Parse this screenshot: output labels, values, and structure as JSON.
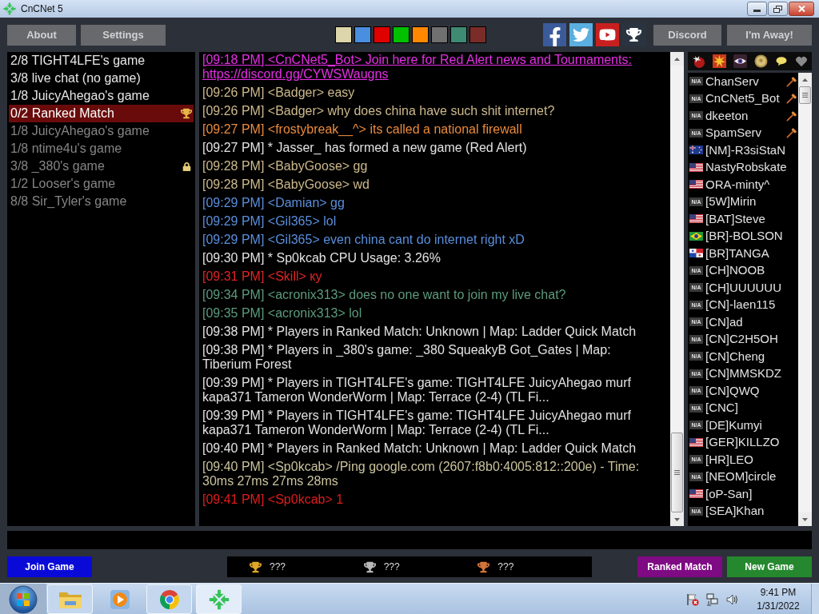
{
  "window": {
    "title": "CnCNet 5"
  },
  "toolbar": {
    "left_buttons": [
      "About",
      "Settings"
    ],
    "color_swatches": [
      {
        "color": "#ddd5ac"
      },
      {
        "color": "#4a8ee0"
      },
      {
        "color": "#e00000"
      },
      {
        "color": "#00c000"
      },
      {
        "color": "#ff8800"
      },
      {
        "color": "#707070"
      },
      {
        "color": "#3e8a72"
      },
      {
        "color": "#7a2c28"
      }
    ],
    "right_buttons": [
      "Discord",
      "I'm Away!"
    ]
  },
  "game_list": [
    {
      "text": "2/8 TIGHT4LFE's game",
      "selected": false,
      "disabled": false,
      "ranked": false,
      "locked": false
    },
    {
      "text": "3/8 live chat (no game)",
      "selected": false,
      "disabled": false,
      "ranked": false,
      "locked": false
    },
    {
      "text": "1/8 JuicyAhegao's game",
      "selected": false,
      "disabled": false,
      "ranked": false,
      "locked": false
    },
    {
      "text": "0/2 Ranked Match",
      "selected": true,
      "disabled": false,
      "ranked": true,
      "locked": false
    },
    {
      "text": "1/8 JuicyAhegao's game",
      "selected": false,
      "disabled": true,
      "ranked": false,
      "locked": false
    },
    {
      "text": "1/8 ntime4u's game",
      "selected": false,
      "disabled": true,
      "ranked": false,
      "locked": false
    },
    {
      "text": "3/8 _380's game",
      "selected": false,
      "disabled": true,
      "ranked": false,
      "locked": true
    },
    {
      "text": "1/2 Looser's game",
      "selected": false,
      "disabled": true,
      "ranked": false,
      "locked": false
    },
    {
      "text": "8/8 Sir_Tyler's game",
      "selected": false,
      "disabled": true,
      "ranked": false,
      "locked": false
    }
  ],
  "chat": [
    {
      "kind": "link",
      "text": "[09:18 PM] <CnCNet5_Bot> Join here for Red Alert news and Tournaments:",
      "link": "https://discord.gg/CYWSWaugns",
      "color": "#e62ee6"
    },
    {
      "kind": "text",
      "text": "[09:26 PM] <Badger> easy",
      "color": "#cdb98c"
    },
    {
      "kind": "text",
      "text": "[09:26 PM] <Badger> why does china have such shit internet?",
      "color": "#cdb98c"
    },
    {
      "kind": "text",
      "text": "[09:27 PM] <frostybreak__^> its called a national firewall",
      "color": "#ea8a3c"
    },
    {
      "kind": "text",
      "text": "[09:27 PM] * Jasser_ has formed a new game (Red Alert)",
      "color": "#e2e2e2"
    },
    {
      "kind": "text",
      "text": "[09:28 PM] <BabyGoose> gg",
      "color": "#cdb98c"
    },
    {
      "kind": "text",
      "text": "[09:28 PM] <BabyGoose> wd",
      "color": "#cdb98c"
    },
    {
      "kind": "text",
      "text": "[09:29 PM] <Damian> gg",
      "color": "#5a8edc"
    },
    {
      "kind": "text",
      "text": "[09:29 PM] <Gil365> lol",
      "color": "#5a8edc"
    },
    {
      "kind": "text",
      "text": "[09:29 PM] <Gil365> even china cant do internet right xD",
      "color": "#5a8edc"
    },
    {
      "kind": "text",
      "text": "[09:30 PM] * Sp0kcab CPU Usage: 3.26%",
      "color": "#e2e2e2"
    },
    {
      "kind": "text",
      "text": "[09:31 PM] <Skill> ку",
      "color": "#e02424"
    },
    {
      "kind": "text",
      "text": "[09:34 PM] <acronix313> does no one want to join my live chat?",
      "color": "#5c9a7e"
    },
    {
      "kind": "text",
      "text": "[09:35 PM] <acronix313> lol",
      "color": "#5c9a7e"
    },
    {
      "kind": "text",
      "text": "[09:38 PM] * Players in Ranked Match: Unknown | Map: Ladder Quick Match",
      "color": "#e2e2e2"
    },
    {
      "kind": "text",
      "text": "[09:38 PM] * Players in _380's game: _380 SqueakyB Got_Gates | Map: Tiberium Forest",
      "color": "#e2e2e2"
    },
    {
      "kind": "text",
      "text": "[09:39 PM] * Players in TIGHT4LFE's game: TIGHT4LFE JuicyAhegao murf kapa371 Tameron WonderWorm | Map: Terrace (2-4) (TL Fi...",
      "color": "#e2e2e2"
    },
    {
      "kind": "text",
      "text": "[09:39 PM] * Players in TIGHT4LFE's game: TIGHT4LFE JuicyAhegao murf kapa371 Tameron WonderWorm | Map: Terrace (2-4) (TL Fi...",
      "color": "#e2e2e2"
    },
    {
      "kind": "text",
      "text": "[09:40 PM] * Players in Ranked Match: Unknown | Map: Ladder Quick Match",
      "color": "#e2e2e2"
    },
    {
      "kind": "text",
      "text": "[09:40 PM] <Sp0kcab> /Ping google.com (2607:f8b0:4005:812::200e) - Time: 30ms 27ms 27ms 28ms",
      "color": "#c9c29c"
    },
    {
      "kind": "text",
      "text": "[09:41 PM] <Sp0kcab> 1",
      "color": "#e01c1c"
    }
  ],
  "users": [
    {
      "name": "ChanServ",
      "kind": "label",
      "flag": "N/A",
      "operator": true
    },
    {
      "name": "CnCNet5_Bot",
      "kind": "label",
      "flag": "N/A",
      "operator": true
    },
    {
      "name": "dkeeton",
      "kind": "label",
      "flag": "N/A",
      "operator": true
    },
    {
      "name": "SpamServ",
      "kind": "label",
      "flag": "N/A",
      "operator": true
    },
    {
      "name": "[NM]-R3siStaN",
      "kind": "au",
      "operator": false
    },
    {
      "name": "NastyRobskate",
      "kind": "us",
      "operator": false
    },
    {
      "name": "ORA-minty^",
      "kind": "us",
      "operator": false
    },
    {
      "name": "[5W]Mirin",
      "kind": "label",
      "flag": "N/A",
      "operator": false
    },
    {
      "name": "[BAT]Steve",
      "kind": "us",
      "operator": false
    },
    {
      "name": "[BR]-BOLSON",
      "kind": "br",
      "operator": false
    },
    {
      "name": "[BR]TANGA",
      "kind": "pa",
      "operator": false
    },
    {
      "name": "[CH]NOOB",
      "kind": "label",
      "flag": "N/A",
      "operator": false
    },
    {
      "name": "[CH]UUUUUU",
      "kind": "label",
      "flag": "N/A",
      "operator": false
    },
    {
      "name": "[CN]-laen115",
      "kind": "label",
      "flag": "N/A",
      "operator": false
    },
    {
      "name": "[CN]ad",
      "kind": "label",
      "flag": "N/A",
      "operator": false
    },
    {
      "name": "[CN]C2H5OH",
      "kind": "label",
      "flag": "N/A",
      "operator": false
    },
    {
      "name": "[CN]Cheng",
      "kind": "label",
      "flag": "N/A",
      "operator": false
    },
    {
      "name": "[CN]MMSKDZ",
      "kind": "label",
      "flag": "N/A",
      "operator": false
    },
    {
      "name": "[CN]QWQ",
      "kind": "label",
      "flag": "N/A",
      "operator": false
    },
    {
      "name": "[CNC]",
      "kind": "label",
      "flag": "N/A",
      "operator": false
    },
    {
      "name": "[DE]Kumyi",
      "kind": "label",
      "flag": "N/A",
      "operator": false
    },
    {
      "name": "[GER]KILLZO",
      "kind": "us",
      "operator": false
    },
    {
      "name": "[HR]LEO",
      "kind": "label",
      "flag": "N/A",
      "operator": false
    },
    {
      "name": "[NEOM]circle",
      "kind": "label",
      "flag": "N/A",
      "operator": false
    },
    {
      "name": "[oP-San]",
      "kind": "us",
      "operator": false
    },
    {
      "name": "[SEA]Khan",
      "kind": "label",
      "flag": "N/A",
      "operator": false
    }
  ],
  "bottom_bar": {
    "join_button": "Join Game",
    "ladder": [
      {
        "color": "#e0a526",
        "text": "???"
      },
      {
        "color": "#b8b8b8",
        "text": "???"
      },
      {
        "color": "#d2753a",
        "text": "???"
      }
    ],
    "ranked_button": "Ranked Match",
    "new_game_button": "New Game"
  },
  "taskbar": {
    "items": [
      {
        "kind": "explorer",
        "running": true,
        "selected": false
      },
      {
        "kind": "media_player",
        "running": false,
        "selected": false
      },
      {
        "kind": "browser",
        "running": true,
        "selected": false
      },
      {
        "kind": "cncnet",
        "running": true,
        "selected": true
      }
    ],
    "clock": {
      "time": "9:41 PM",
      "date": "1/31/2022"
    }
  }
}
